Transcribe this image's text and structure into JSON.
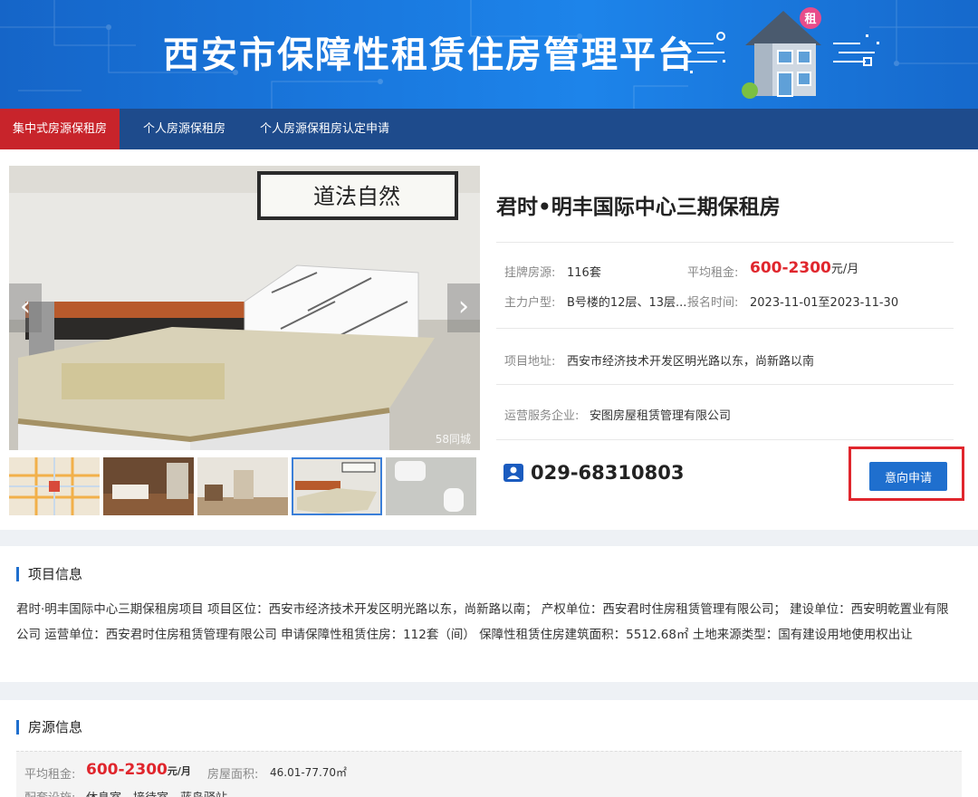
{
  "banner": {
    "title": "西安市保障性租赁住房管理平台",
    "badge": "租"
  },
  "nav": {
    "items": [
      "集中式房源保租房",
      "个人房源保租房",
      "个人房源保租房认定申请"
    ]
  },
  "project": {
    "title": "君时•明丰国际中心三期保租房",
    "listed_label": "挂牌房源:",
    "listed_value": "116套",
    "avg_rent_label": "平均租金:",
    "avg_rent_value": "600-2300",
    "avg_rent_unit": "元/月",
    "layout_label": "主力户型:",
    "layout_value": "B号楼的12层、13层...",
    "signup_label": "报名时间:",
    "signup_value": "2023-11-01至2023-11-30",
    "address_label": "项目地址:",
    "address_value": "西安市经济技术开发区明光路以东，尚新路以南",
    "operator_label": "运营服务企业:",
    "operator_value": "安图房屋租赁管理有限公司",
    "phone": "029-68310803",
    "apply_label": "意向申请",
    "photo_watermark": "58同城",
    "calligraphy": "道法自然"
  },
  "project_info": {
    "heading": "项目信息",
    "body": "君时·明丰国际中心三期保租房项目 项目区位：西安市经济技术开发区明光路以东，尚新路以南； 产权单位：西安君时住房租赁管理有限公司； 建设单位：西安明乾置业有限公司 运营单位：西安君时住房租赁管理有限公司 申请保障性租赁住房：112套（间） 保障性租赁住房建筑面积：5512.68㎡ 土地来源类型：国有建设用地使用权出让"
  },
  "listing_info": {
    "heading": "房源信息",
    "avg_rent_label": "平均租金:",
    "avg_rent_value": "600-2300",
    "avg_rent_unit": "元/月",
    "area_label": "房屋面积:",
    "area_value": "46.01-77.70㎡",
    "facilities_label": "配套设施:",
    "facilities_value": "休息室、接待室、蓝岛驿站"
  },
  "colors": {
    "accent": "#1f6fce",
    "nav_bg": "#1e4b8c",
    "active_tab": "#c8242b",
    "price": "#e0262d"
  }
}
